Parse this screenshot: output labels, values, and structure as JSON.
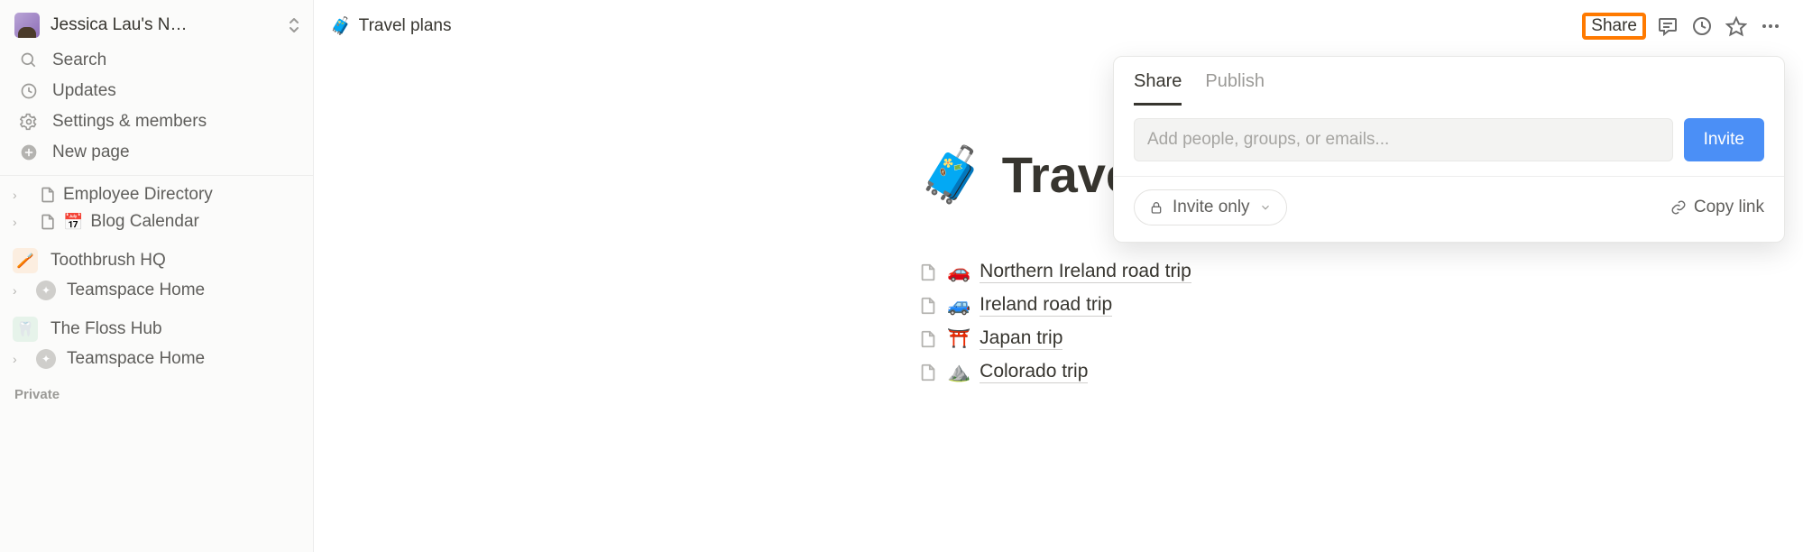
{
  "workspace": {
    "name": "Jessica Lau's N…"
  },
  "nav": {
    "search": "Search",
    "updates": "Updates",
    "settings": "Settings & members",
    "newpage": "New page"
  },
  "tree": {
    "top": [
      {
        "label": "Employee Directory",
        "emoji": ""
      },
      {
        "label": "Blog Calendar",
        "emoji": "📅"
      }
    ],
    "ws1": {
      "name": "Toothbrush HQ",
      "badge_emoji": "🪥",
      "home": "Teamspace Home"
    },
    "ws2": {
      "name": "The Floss Hub",
      "badge_emoji": "🦷",
      "home": "Teamspace Home"
    },
    "private_label": "Private"
  },
  "breadcrumb": {
    "emoji": "🧳",
    "label": "Travel plans"
  },
  "topbar": {
    "share": "Share"
  },
  "page": {
    "emoji": "🧳",
    "title": "Travel plans",
    "subpages": [
      {
        "emoji": "🚗",
        "label": "Northern Ireland road trip"
      },
      {
        "emoji": "🚙",
        "label": "Ireland road trip"
      },
      {
        "emoji": "⛩️",
        "label": "Japan trip"
      },
      {
        "emoji": "⛰️",
        "label": "Colorado trip"
      }
    ]
  },
  "share_popover": {
    "tabs": {
      "share": "Share",
      "publish": "Publish"
    },
    "placeholder": "Add people, groups, or emails...",
    "invite": "Invite",
    "access": "Invite only",
    "copy": "Copy link"
  }
}
